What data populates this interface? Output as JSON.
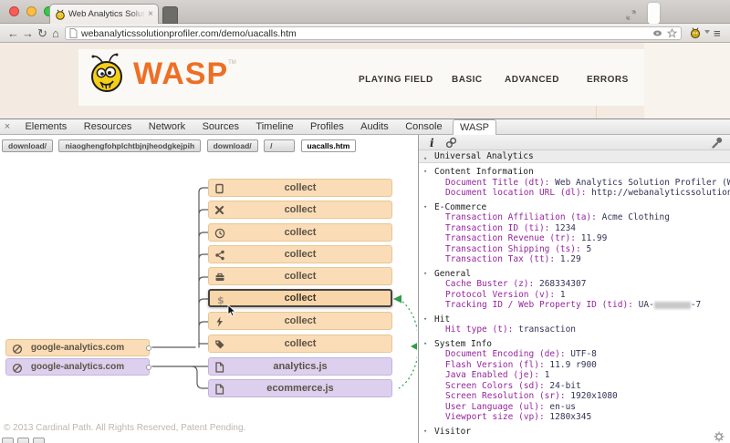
{
  "colors": {
    "page_background": "#f3eae1",
    "brand_orange": "#ee6f24",
    "node_orange": "#fadcb6",
    "node_purple": "#ddd0ee",
    "key_purple": "#97249f",
    "value_navy": "#333355",
    "arc_green": "#2f9e44",
    "traffic_red": "#fc5b57",
    "traffic_yellow": "#fdbe41",
    "traffic_green": "#35c84a"
  },
  "browser": {
    "tab_title": "Web Analytics Solution Pr",
    "tab_close": "×",
    "url": "webanalyticssolutionprofiler.com/demo/uacalls.htm",
    "toolbar_icons": [
      "back-icon",
      "forward-icon",
      "reload-icon",
      "home-icon",
      "page-icon",
      "eye-icon",
      "bookmark-star-icon",
      "bee-extension-icon",
      "menu-icon"
    ],
    "back_glyph": "←",
    "forward_glyph": "→",
    "reload_glyph": "↻",
    "home_glyph": "⌂",
    "menu_glyph": "≡"
  },
  "page": {
    "logo_text": "WASP",
    "logo_tm": "TM",
    "nav": [
      {
        "label": "PLAYING FIELD"
      },
      {
        "label": "BASIC"
      },
      {
        "label": "ADVANCED"
      },
      {
        "label": "ERRORS"
      }
    ],
    "footer": "© 2013 Cardinal Path. All Rights Reserved, Patent Pending."
  },
  "devtools": {
    "close_glyph": "×",
    "tabs": [
      {
        "label": "Elements",
        "active": false
      },
      {
        "label": "Resources",
        "active": false
      },
      {
        "label": "Network",
        "active": false
      },
      {
        "label": "Sources",
        "active": false
      },
      {
        "label": "Timeline",
        "active": false
      },
      {
        "label": "Profiles",
        "active": false
      },
      {
        "label": "Audits",
        "active": false
      },
      {
        "label": "Console",
        "active": false
      },
      {
        "label": "WASP",
        "active": true
      }
    ],
    "subtabs": [
      {
        "label": "download/",
        "active": false
      },
      {
        "label": "niaoghengfohplchtbjnjheodgkejpih",
        "active": false
      },
      {
        "label": "download/",
        "active": false
      },
      {
        "label": "/",
        "active": false
      },
      {
        "label": "uacalls.htm",
        "active": true
      }
    ]
  },
  "tree": {
    "sources": [
      {
        "label": "google-analytics.com",
        "color": "orange",
        "icon": "blocked-globe-icon"
      },
      {
        "label": "google-analytics.com",
        "color": "purple",
        "icon": "blocked-globe-icon"
      }
    ],
    "nodes": [
      {
        "label": "collect",
        "color": "orange",
        "icon": "page-icon",
        "selected": false
      },
      {
        "label": "collect",
        "color": "orange",
        "icon": "close-x-icon",
        "selected": false
      },
      {
        "label": "collect",
        "color": "orange",
        "icon": "clock-icon",
        "selected": false
      },
      {
        "label": "collect",
        "color": "orange",
        "icon": "share-icon",
        "selected": false
      },
      {
        "label": "collect",
        "color": "orange",
        "icon": "briefcase-icon",
        "selected": false
      },
      {
        "label": "collect",
        "color": "orange",
        "icon": "dollar-icon",
        "selected": true
      },
      {
        "label": "collect",
        "color": "orange",
        "icon": "lightning-icon",
        "selected": false
      },
      {
        "label": "collect",
        "color": "orange",
        "icon": "tag-icon",
        "selected": false
      },
      {
        "label": "analytics.js",
        "color": "purple",
        "icon": "file-icon",
        "selected": false
      },
      {
        "label": "ecommerce.js",
        "color": "purple",
        "icon": "file-icon",
        "selected": false
      }
    ]
  },
  "details": {
    "toolbar_icons": [
      "info-icon",
      "link-icon",
      "wrench-icon"
    ],
    "title": "Universal Analytics",
    "sections": [
      {
        "title": "Content Information",
        "entries": [
          {
            "key": "Document Title (dt):",
            "value": "Web Analytics Solution Profiler (WASP) …"
          },
          {
            "key": "Document location URL (dl):",
            "value": "http://webanalyticssolutionprofi…"
          }
        ]
      },
      {
        "title": "E-Commerce",
        "entries": [
          {
            "key": "Transaction Affiliation (ta):",
            "value": "Acme Clothing"
          },
          {
            "key": "Transaction ID (ti):",
            "value": "1234"
          },
          {
            "key": "Transaction Revenue (tr):",
            "value": "11.99"
          },
          {
            "key": "Transaction Shipping (ts):",
            "value": "5"
          },
          {
            "key": "Transaction Tax (tt):",
            "value": "1.29"
          }
        ]
      },
      {
        "title": "General",
        "entries": [
          {
            "key": "Cache Buster (z):",
            "value": "268334307"
          },
          {
            "key": "Protocol Version (v):",
            "value": "1"
          },
          {
            "key": "Tracking ID / Web Property ID (tid):",
            "value": "UA-",
            "value_suffix": "-7",
            "redacted": true
          }
        ]
      },
      {
        "title": "Hit",
        "entries": [
          {
            "key": "Hit type (t):",
            "value": "transaction"
          }
        ]
      },
      {
        "title": "System Info",
        "entries": [
          {
            "key": "Document Encoding (de):",
            "value": "UTF-8"
          },
          {
            "key": "Flash Version (fl):",
            "value": "11.9 r900"
          },
          {
            "key": "Java Enabled (je):",
            "value": "1"
          },
          {
            "key": "Screen Colors (sd):",
            "value": "24-bit"
          },
          {
            "key": "Screen Resolution (sr):",
            "value": "1920x1080"
          },
          {
            "key": "User Language (ul):",
            "value": "en-us"
          },
          {
            "key": "Viewport size (vp):",
            "value": "1280x345"
          }
        ]
      },
      {
        "title": "Visitor",
        "entries": []
      }
    ]
  }
}
